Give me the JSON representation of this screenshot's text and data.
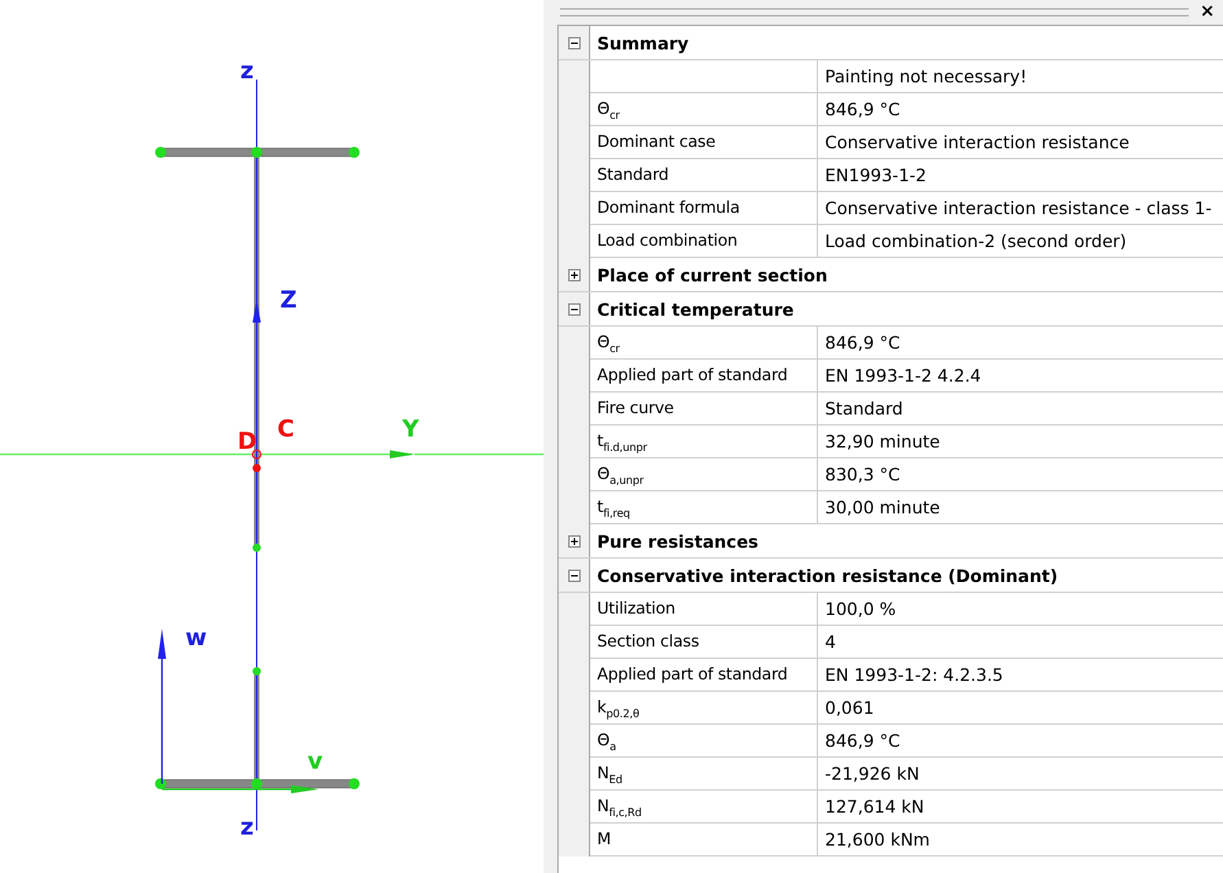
{
  "drawing": {
    "labels": [
      {
        "text": "z",
        "color": "#1f1fe0"
      },
      {
        "text": "Z",
        "color": "#1f1fe0"
      },
      {
        "text": "Y",
        "color": "#22cc22"
      },
      {
        "text": "D",
        "color": "#ee1111"
      },
      {
        "text": "C",
        "color": "#ee1111"
      },
      {
        "text": "w",
        "color": "#1f1fe0"
      },
      {
        "text": "v",
        "color": "#22cc22"
      },
      {
        "text": "z",
        "color": "#1f1fe0"
      }
    ]
  },
  "panel": {
    "close": "×",
    "sections": [
      {
        "title": "Summary",
        "expanded": true,
        "rows": [
          {
            "value": "Painting not necessary!"
          },
          {
            "label": "Θ$_{cr}$",
            "value": "846,9 °C"
          },
          {
            "label": "Dominant case",
            "value": "Conservative interaction resistance"
          },
          {
            "label": "Standard",
            "value": "EN1993-1-2"
          },
          {
            "label": "Dominant formula",
            "value": "Conservative interaction resistance - class 1-"
          },
          {
            "label": "Load combination",
            "value": "Load combination-2 (second order)"
          }
        ]
      },
      {
        "title": "Place of current section",
        "expanded": false
      },
      {
        "title": "Critical temperature",
        "expanded": true,
        "rows": [
          {
            "label": "Θ$_{cr}$",
            "value": "846,9 °C"
          },
          {
            "label": "Applied part of standard",
            "value": "EN 1993-1-2 4.2.4"
          },
          {
            "label": "Fire curve",
            "value": "Standard"
          },
          {
            "label": "t$_{fi.d,unpr}$",
            "value": "32,90 minute"
          },
          {
            "label": "Θ$_{a,unpr}$",
            "value": "830,3 °C"
          },
          {
            "label": "t$_{fi,req}$",
            "value": "30,00 minute"
          }
        ]
      },
      {
        "title": "Pure resistances",
        "expanded": false
      },
      {
        "title": "Conservative interaction resistance (Dominant)",
        "expanded": true,
        "rows": [
          {
            "label": "Utilization",
            "value": "100,0 %"
          },
          {
            "label": "Section class",
            "value": "4"
          },
          {
            "label": "Applied part of standard",
            "value": "EN 1993-1-2: 4.2.3.5"
          },
          {
            "label": "k$_{p0.2,θ}$",
            "value": "0,061"
          },
          {
            "label": "Θ$_{a}$",
            "value": "846,9 °C"
          },
          {
            "label": "N$_{Ed}$",
            "value": "-21,926 kN"
          },
          {
            "label": "N$_{fi,c,Rd}$",
            "value": "127,614 kN"
          },
          {
            "label": "M",
            "value": "21,600 kNm"
          }
        ]
      }
    ]
  }
}
